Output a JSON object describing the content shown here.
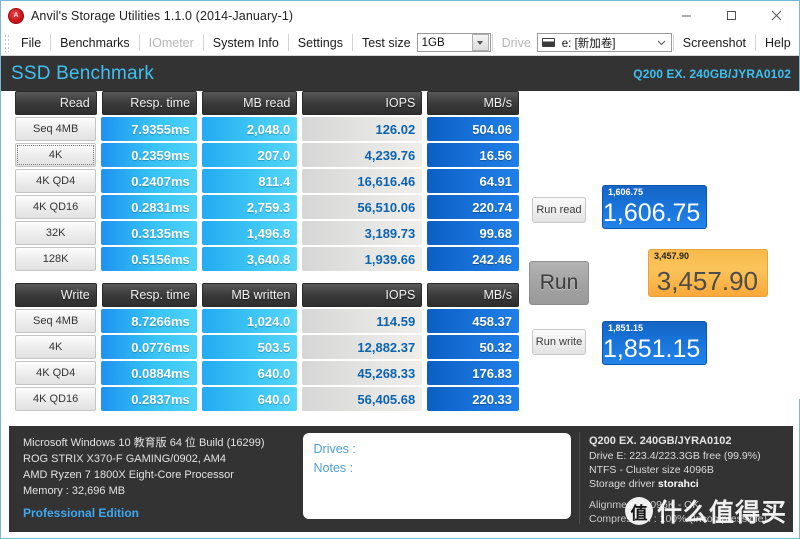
{
  "window": {
    "title": "Anvil's Storage Utilities 1.1.0 (2014-January-1)",
    "icon": "anvil-app-icon",
    "minimize": "–",
    "maximize": "☐",
    "close": "✕"
  },
  "menu": {
    "items": [
      {
        "label": "File",
        "disabled": false
      },
      {
        "label": "Benchmarks",
        "disabled": false
      },
      {
        "label": "IOmeter",
        "disabled": true
      },
      {
        "label": "System Info",
        "disabled": false
      },
      {
        "label": "Settings",
        "disabled": false
      }
    ],
    "test_size_label": "Test size",
    "test_size_value": "1GB",
    "drive_label": "Drive",
    "drive_value": "e: [新加卷]",
    "screenshot_label": "Screenshot",
    "help_label": "Help"
  },
  "header": {
    "title": "SSD Benchmark",
    "drive_model": "Q200 EX. 240GB/JYRA0102",
    "accent": "#3fc0f0",
    "background": "#333333"
  },
  "read_table": {
    "columns": [
      "Read",
      "Resp. time",
      "MB read",
      "IOPS",
      "MB/s"
    ],
    "rows": [
      {
        "label": "Seq 4MB",
        "resp": "7.9355ms",
        "mb": "2,048.0",
        "iops": "126.02",
        "mbs": "504.06",
        "focused": false
      },
      {
        "label": "4K",
        "resp": "0.2359ms",
        "mb": "207.0",
        "iops": "4,239.76",
        "mbs": "16.56",
        "focused": true
      },
      {
        "label": "4K QD4",
        "resp": "0.2407ms",
        "mb": "811.4",
        "iops": "16,616.46",
        "mbs": "64.91",
        "focused": false
      },
      {
        "label": "4K QD16",
        "resp": "0.2831ms",
        "mb": "2,759.3",
        "iops": "56,510.06",
        "mbs": "220.74",
        "focused": false
      },
      {
        "label": "32K",
        "resp": "0.3135ms",
        "mb": "1,496.8",
        "iops": "3,189.73",
        "mbs": "99.68",
        "focused": false
      },
      {
        "label": "128K",
        "resp": "0.5156ms",
        "mb": "3,640.8",
        "iops": "1,939.66",
        "mbs": "242.46",
        "focused": false
      }
    ]
  },
  "write_table": {
    "columns": [
      "Write",
      "Resp. time",
      "MB written",
      "IOPS",
      "MB/s"
    ],
    "rows": [
      {
        "label": "Seq 4MB",
        "resp": "8.7266ms",
        "mb": "1,024.0",
        "iops": "114.59",
        "mbs": "458.37",
        "focused": false
      },
      {
        "label": "4K",
        "resp": "0.0776ms",
        "mb": "503.5",
        "iops": "12,882.37",
        "mbs": "50.32",
        "focused": false
      },
      {
        "label": "4K QD4",
        "resp": "0.0884ms",
        "mb": "640.0",
        "iops": "45,268.33",
        "mbs": "176.83",
        "focused": false
      },
      {
        "label": "4K QD16",
        "resp": "0.2837ms",
        "mb": "640.0",
        "iops": "56,405.68",
        "mbs": "220.33",
        "focused": false
      }
    ]
  },
  "controls": {
    "run_read": "Run read",
    "run": "Run",
    "run_write": "Run write",
    "read_score_label": "1,606.75",
    "read_score_value": "1,606.75",
    "total_score_label": "3,457.90",
    "total_score_value": "3,457.90",
    "write_score_label": "1,851.15",
    "write_score_value": "1,851.15",
    "score_blue": "#1873d8",
    "score_orange": "#f9b44a"
  },
  "footer": {
    "system": [
      "Microsoft Windows 10 教育版 64 位 Build (16299)",
      "ROG STRIX X370-F GAMING/0902, AM4",
      "AMD Ryzen 7 1800X Eight-Core Processor",
      "Memory : 32,696 MB"
    ],
    "edition": "Professional Edition",
    "notes": {
      "drives_label": "Drives :",
      "notes_label": "Notes :"
    },
    "drive_info": {
      "title": "Q200 EX. 240GB/JYRA0102",
      "lines": [
        "Drive E: 223.4/223.3GB free (99.9%)",
        "NTFS - Cluster size 4096B"
      ],
      "storage_driver_label": "Storage driver",
      "storage_driver_value": "storahci",
      "alignment": "Alignment :  4096K - OK",
      "compression": "Compression : 100% (Incompressible)"
    },
    "watermark": {
      "badge": "值",
      "text": "什么值得买"
    }
  }
}
